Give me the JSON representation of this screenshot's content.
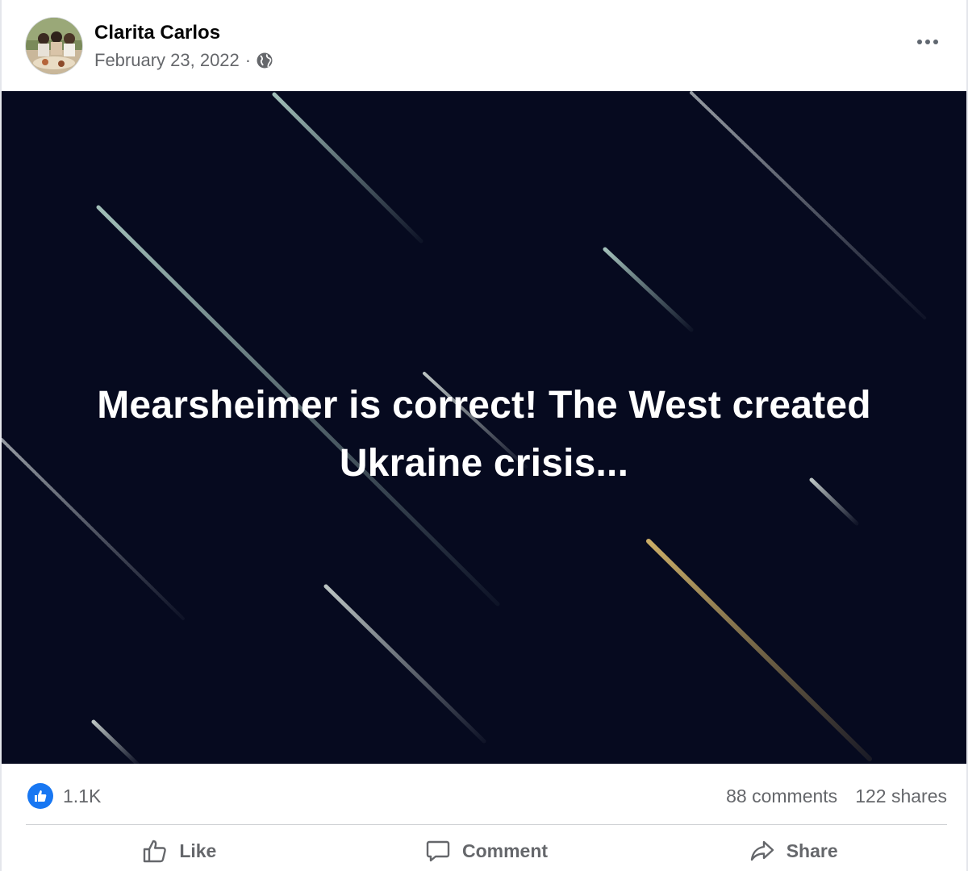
{
  "post": {
    "author": "Clarita Carlos",
    "date": "February 23, 2022",
    "separator": "·",
    "privacy_icon": "globe-icon",
    "more_icon": "more-options-icon"
  },
  "media": {
    "overlay_line1": "Mearsheimer is correct! The West created",
    "overlay_line2": "Ukraine crisis...",
    "background_color": "#060a1f"
  },
  "stats": {
    "reactions": "1.1K",
    "reaction_icon": "like-icon",
    "comments": "88 comments",
    "shares": "122 shares"
  },
  "actions": {
    "like": "Like",
    "comment": "Comment",
    "share": "Share"
  },
  "colors": {
    "accent": "#1877f2",
    "secondary_text": "#65676b",
    "primary_text": "#050505"
  }
}
